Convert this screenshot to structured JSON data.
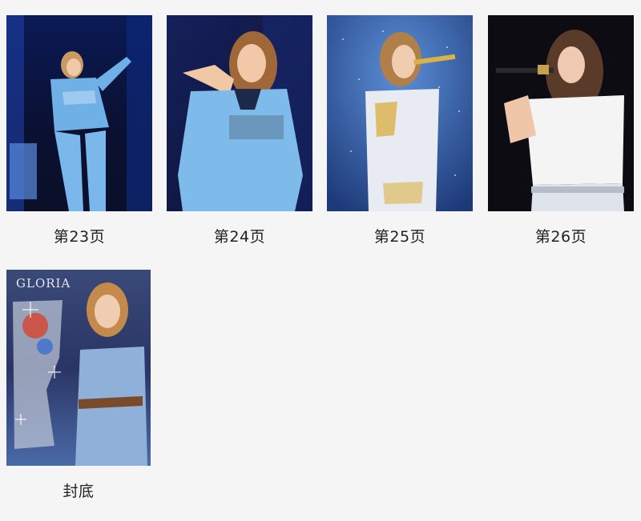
{
  "pages": [
    {
      "label": "第23页",
      "image": "performer-blue-jersey-pointing-photo"
    },
    {
      "label": "第24页",
      "image": "performer-blue-jersey-closeup-photo"
    },
    {
      "label": "第25页",
      "image": "performer-white-sequin-singing-photo"
    },
    {
      "label": "第26页",
      "image": "performer-white-tee-microphone-photo"
    },
    {
      "label": "封底",
      "image": "performer-trophy-gloria-cover-photo",
      "cover_text": "GLORIA"
    }
  ],
  "colors": {
    "background": "#f5f5f5",
    "label_text": "#222222"
  }
}
